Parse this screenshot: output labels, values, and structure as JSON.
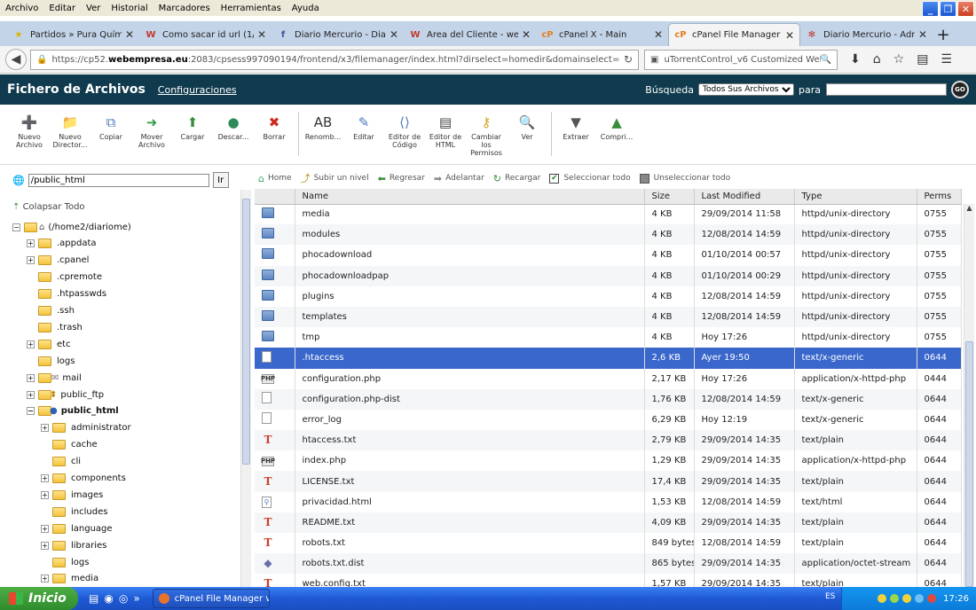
{
  "menubar": [
    "Archivo",
    "Editar",
    "Ver",
    "Historial",
    "Marcadores",
    "Herramientas",
    "Ayuda"
  ],
  "window_controls": {
    "minimize": "_",
    "maximize": "❐",
    "close": "✕"
  },
  "tabs": [
    {
      "label": "Partidos » Pura Quími...",
      "icon": "star-icon",
      "icon_color": "#e0b400"
    },
    {
      "label": "Como sacar id url (1/1...",
      "icon": "w-logo-icon",
      "icon_color": "#c0392b"
    },
    {
      "label": "Diario Mercurio - Diari...",
      "icon": "facebook-icon",
      "icon_color": "#3b5998"
    },
    {
      "label": "Área del Cliente - web...",
      "icon": "w-logo-icon",
      "icon_color": "#c0392b"
    },
    {
      "label": "cPanel X - Main",
      "icon": "cpanel-icon",
      "icon_color": "#e67e22"
    },
    {
      "label": "cPanel File Manager v3",
      "icon": "cpanel-icon",
      "icon_color": "#e67e22",
      "active": true
    },
    {
      "label": "Diario Mercurio - Admi...",
      "icon": "joomla-icon",
      "icon_color": "#c0392b"
    }
  ],
  "new_tab_label": "+",
  "url": {
    "prefix": "https://cp52.",
    "domain": "webempresa.eu",
    "rest": ":2083/cpsess997090194/frontend/x3/filemanager/index.html?dirselect=homedir&domainselect=diariomercurio.com.ar&dir="
  },
  "search_engine_text": "uTorrentControl_v6 Customized Web Sea",
  "fm": {
    "title": "Fichero de Archivos",
    "config_link": "Configuraciones",
    "search_label": "Búsqueda",
    "search_scope": "Todos Sus Archivos",
    "search_for": "para",
    "go": "GO"
  },
  "toolbar": [
    {
      "label": "Nuevo Archivo",
      "icon": "new-file-icon",
      "glyph": "➕",
      "color": "#3a8d3a"
    },
    {
      "label": "Nuevo Director...",
      "icon": "new-folder-icon",
      "glyph": "📁",
      "color": "#d9a21b"
    },
    {
      "label": "Copiar",
      "icon": "copy-icon",
      "glyph": "⧉",
      "color": "#4b7ac2"
    },
    {
      "label": "Mover Archivo",
      "icon": "move-icon",
      "glyph": "➜",
      "color": "#2e9d45"
    },
    {
      "label": "Cargar",
      "icon": "upload-icon",
      "glyph": "⬆",
      "color": "#3a8d3a"
    },
    {
      "label": "Descar...",
      "icon": "download-icon",
      "glyph": "●",
      "color": "#2e8b57"
    },
    {
      "label": "Borrar",
      "icon": "delete-icon",
      "glyph": "✖",
      "color": "#d0281c"
    },
    {
      "sep": true
    },
    {
      "label": "Renomb...",
      "icon": "rename-icon",
      "glyph": "AB",
      "color": "#333"
    },
    {
      "label": "Editar",
      "icon": "edit-icon",
      "glyph": "✎",
      "color": "#4b7ac2"
    },
    {
      "label": "Editor de Código",
      "icon": "code-editor-icon",
      "glyph": "⟨⟩",
      "color": "#4b7ac2"
    },
    {
      "label": "Editor de HTML",
      "icon": "html-editor-icon",
      "glyph": "▤",
      "color": "#444"
    },
    {
      "label": "Cambiar los Permisos",
      "icon": "key-icon",
      "glyph": "⚷",
      "color": "#d9a21b"
    },
    {
      "label": "Ver",
      "icon": "view-icon",
      "glyph": "🔍",
      "color": "#4b7ac2"
    },
    {
      "sep": true
    },
    {
      "label": "Extraer",
      "icon": "extract-icon",
      "glyph": "▼",
      "color": "#555"
    },
    {
      "label": "Compri...",
      "icon": "compress-icon",
      "glyph": "▲",
      "color": "#3a8d3a"
    }
  ],
  "left": {
    "path_value": "/public_html",
    "go_label": "Ir",
    "collapse_label": "Colapsar Todo",
    "tree": [
      {
        "label": "(/home2/diariome)",
        "level": 0,
        "exp": "−",
        "kind": "home"
      },
      {
        "label": ".appdata",
        "level": 1,
        "exp": "+"
      },
      {
        "label": ".cpanel",
        "level": 1,
        "exp": "+"
      },
      {
        "label": ".cpremote",
        "level": 1,
        "exp": ""
      },
      {
        "label": ".htpasswds",
        "level": 1,
        "exp": ""
      },
      {
        "label": ".ssh",
        "level": 1,
        "exp": ""
      },
      {
        "label": ".trash",
        "level": 1,
        "exp": ""
      },
      {
        "label": "etc",
        "level": 1,
        "exp": "+"
      },
      {
        "label": "logs",
        "level": 1,
        "exp": ""
      },
      {
        "label": "mail",
        "level": 1,
        "exp": "+",
        "kind": "mail"
      },
      {
        "label": "public_ftp",
        "level": 1,
        "exp": "+",
        "kind": "ftp"
      },
      {
        "label": "public_html",
        "level": 1,
        "exp": "−",
        "kind": "web",
        "bold": true
      },
      {
        "label": "administrator",
        "level": 2,
        "exp": "+"
      },
      {
        "label": "cache",
        "level": 2,
        "exp": ""
      },
      {
        "label": "cli",
        "level": 2,
        "exp": ""
      },
      {
        "label": "components",
        "level": 2,
        "exp": "+"
      },
      {
        "label": "images",
        "level": 2,
        "exp": "+"
      },
      {
        "label": "includes",
        "level": 2,
        "exp": ""
      },
      {
        "label": "language",
        "level": 2,
        "exp": "+"
      },
      {
        "label": "libraries",
        "level": 2,
        "exp": "+"
      },
      {
        "label": "logs",
        "level": 2,
        "exp": ""
      },
      {
        "label": "media",
        "level": 2,
        "exp": "+"
      }
    ]
  },
  "nav": [
    {
      "label": "Home",
      "icon": "home-icon",
      "glyph": "⌂"
    },
    {
      "label": "Subir un nivel",
      "icon": "up-level-icon",
      "glyph": "⤴"
    },
    {
      "label": "Regresar",
      "icon": "back-icon",
      "glyph": "⬅"
    },
    {
      "label": "Adelantar",
      "icon": "forward-icon",
      "glyph": "➡"
    },
    {
      "label": "Recargar",
      "icon": "reload-icon",
      "glyph": "↻"
    }
  ],
  "select_all": "Seleccionar todo",
  "unselect_all": "Unseleccionar todo",
  "columns": [
    "Name",
    "Size",
    "Last Modified",
    "Type",
    "Perms"
  ],
  "files": [
    {
      "name": "media",
      "size": "4 KB",
      "modified": "29/09/2014 11:58",
      "type": "httpd/unix-directory",
      "perms": "0755",
      "icon": "folder"
    },
    {
      "name": "modules",
      "size": "4 KB",
      "modified": "12/08/2014 14:59",
      "type": "httpd/unix-directory",
      "perms": "0755",
      "icon": "folder"
    },
    {
      "name": "phocadownload",
      "size": "4 KB",
      "modified": "01/10/2014 00:57",
      "type": "httpd/unix-directory",
      "perms": "0755",
      "icon": "folder"
    },
    {
      "name": "phocadownloadpap",
      "size": "4 KB",
      "modified": "01/10/2014 00:29",
      "type": "httpd/unix-directory",
      "perms": "0755",
      "icon": "folder"
    },
    {
      "name": "plugins",
      "size": "4 KB",
      "modified": "12/08/2014 14:59",
      "type": "httpd/unix-directory",
      "perms": "0755",
      "icon": "folder"
    },
    {
      "name": "templates",
      "size": "4 KB",
      "modified": "12/08/2014 14:59",
      "type": "httpd/unix-directory",
      "perms": "0755",
      "icon": "folder"
    },
    {
      "name": "tmp",
      "size": "4 KB",
      "modified": "Hoy 17:26",
      "type": "httpd/unix-directory",
      "perms": "0755",
      "icon": "folder"
    },
    {
      "name": ".htaccess",
      "size": "2,6 KB",
      "modified": "Ayer 19:50",
      "type": "text/x-generic",
      "perms": "0644",
      "icon": "doc",
      "selected": true
    },
    {
      "name": "configuration.php",
      "size": "2,17 KB",
      "modified": "Hoy 17:26",
      "type": "application/x-httpd-php",
      "perms": "0444",
      "icon": "php"
    },
    {
      "name": "configuration.php-dist",
      "size": "1,76 KB",
      "modified": "12/08/2014 14:59",
      "type": "text/x-generic",
      "perms": "0644",
      "icon": "doc"
    },
    {
      "name": "error_log",
      "size": "6,29 KB",
      "modified": "Hoy 12:19",
      "type": "text/x-generic",
      "perms": "0644",
      "icon": "doc"
    },
    {
      "name": "htaccess.txt",
      "size": "2,79 KB",
      "modified": "29/09/2014 14:35",
      "type": "text/plain",
      "perms": "0644",
      "icon": "txt"
    },
    {
      "name": "index.php",
      "size": "1,29 KB",
      "modified": "29/09/2014 14:35",
      "type": "application/x-httpd-php",
      "perms": "0644",
      "icon": "php"
    },
    {
      "name": "LICENSE.txt",
      "size": "17,4 KB",
      "modified": "29/09/2014 14:35",
      "type": "text/plain",
      "perms": "0644",
      "icon": "txt"
    },
    {
      "name": "privacidad.html",
      "size": "1,53 KB",
      "modified": "12/08/2014 14:59",
      "type": "text/html",
      "perms": "0644",
      "icon": "html"
    },
    {
      "name": "README.txt",
      "size": "4,09 KB",
      "modified": "29/09/2014 14:35",
      "type": "text/plain",
      "perms": "0644",
      "icon": "txt"
    },
    {
      "name": "robots.txt",
      "size": "849 bytes",
      "modified": "12/08/2014 14:59",
      "type": "text/plain",
      "perms": "0644",
      "icon": "txt"
    },
    {
      "name": "robots.txt.dist",
      "size": "865 bytes",
      "modified": "29/09/2014 14:35",
      "type": "application/octet-stream",
      "perms": "0644",
      "icon": "dist"
    },
    {
      "name": "web.config.txt",
      "size": "1,57 KB",
      "modified": "29/09/2014 14:35",
      "type": "text/plain",
      "perms": "0644",
      "icon": "txt"
    }
  ],
  "taskbar": {
    "start": "Inicio",
    "item": "cPanel File Manager v...",
    "lang": "ES",
    "clock": "17:26"
  }
}
